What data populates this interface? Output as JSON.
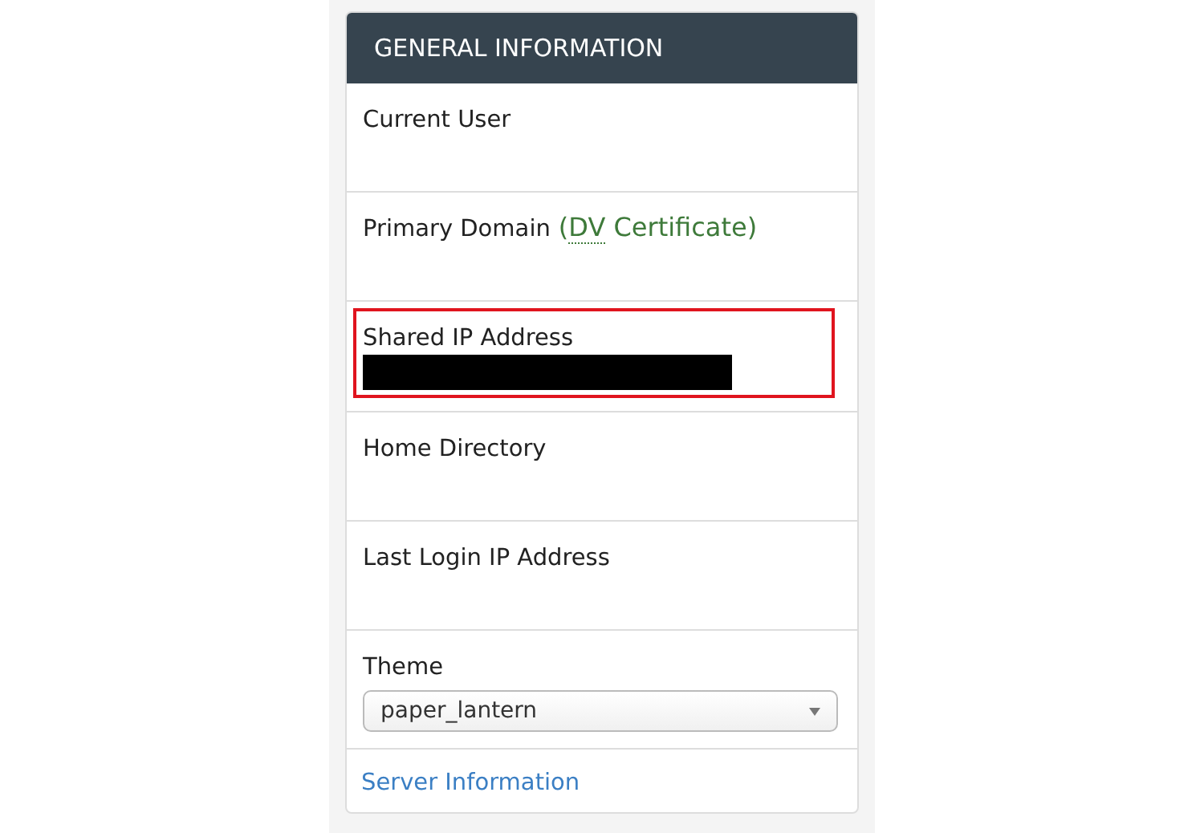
{
  "panel": {
    "title": "GENERAL INFORMATION",
    "rows": [
      {
        "kind": "text",
        "label": "Current User",
        "highlighted": false
      },
      {
        "kind": "text",
        "label": "Primary Domain",
        "note": {
          "before": "(",
          "abbr": "DV",
          "after": " Certificate)"
        },
        "highlighted": false
      },
      {
        "kind": "redacted",
        "label": "Shared IP Address",
        "highlighted": true
      },
      {
        "kind": "text",
        "label": "Home Directory",
        "highlighted": false
      },
      {
        "kind": "text",
        "label": "Last Login IP Address",
        "highlighted": false
      },
      {
        "kind": "select",
        "label": "Theme",
        "value": "paper_lantern",
        "highlighted": false
      }
    ],
    "footer_link": "Server Information"
  }
}
